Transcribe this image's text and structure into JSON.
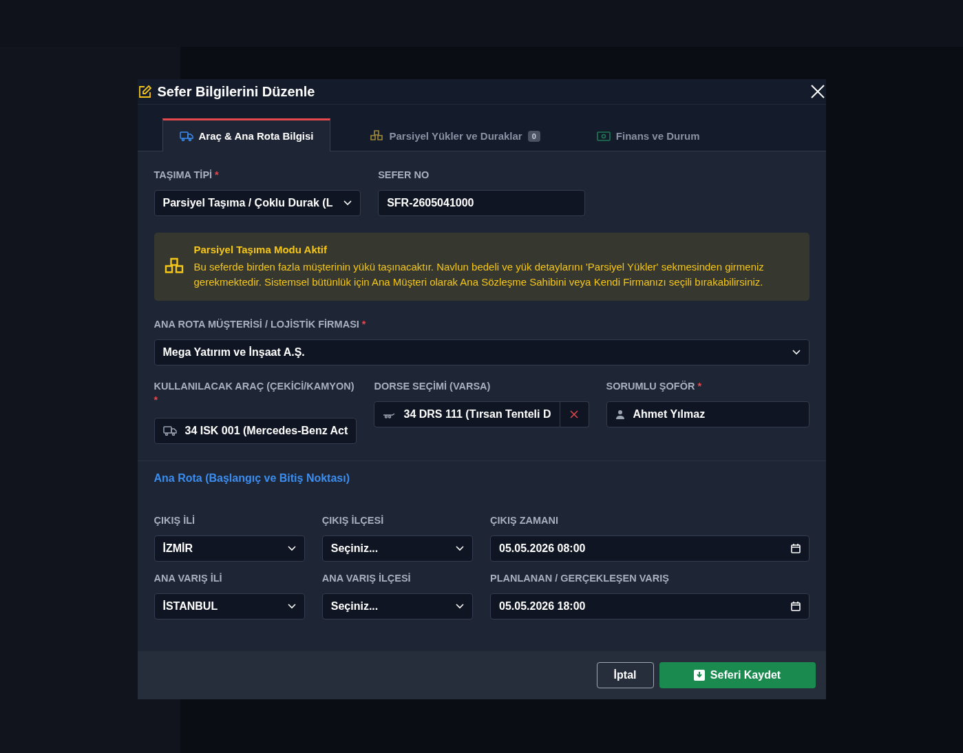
{
  "modal": {
    "title": "Sefer Bilgilerini Düzenle"
  },
  "tabs": [
    {
      "label": "Araç & Ana Rota Bilgisi",
      "selected": true,
      "kind": "truck"
    },
    {
      "label": "Parsiyel Yükler ve Duraklar",
      "selected": false,
      "kind": "boxes",
      "badge": "0"
    },
    {
      "label": "Finans ve Durum",
      "selected": false,
      "kind": "money"
    }
  ],
  "top_fields": [
    {
      "label": "TAŞIMA TİPİ",
      "required_mark": "*",
      "value": "Parsiyel Taşıma / Çoklu Durak (L",
      "kind": "select"
    },
    {
      "label": "SEFER NO",
      "value": "SFR-2605041000",
      "kind": "text"
    }
  ],
  "notice": {
    "title": "Parsiyel Taşıma Modu Aktif",
    "text": "Bu seferde birden fazla müşterinin yükü taşınacaktır. Navlun bedeli ve yük detaylarını 'Parsiyel Yükler' sekmesinden girmeniz gerekmektedir. Sistemsel bütünlük için Ana Müşteri olarak Ana Sözleşme Sahibini veya Kendi Firmanızı seçili bırakabilirsiniz."
  },
  "customer": {
    "label": "ANA ROTA MÜŞTERİSİ / LOJİSTİK FİRMASI",
    "required_mark": "*",
    "value": "Mega Yatırım ve İnşaat A.Ş."
  },
  "assignments": [
    {
      "label": "KULLANILACAK ARAÇ (ÇEKİCİ/KAMYON)",
      "required_mark": "*",
      "value": "34 ISK 001 (Mercedes-Benz Act",
      "kind": "truck"
    },
    {
      "label": "DORSE SEÇİMİ (VARSA)",
      "value": "34 DRS 111 (Tırsan Tenteli D",
      "kind": "trailer"
    },
    {
      "label": "SORUMLU ŞOFÖR",
      "required_mark": "*",
      "value": "Ahmet Yılmaz",
      "kind": "driver"
    }
  ],
  "route": {
    "title": "Ana Rota (Başlangıç ve Bitiş Noktası)",
    "fields": [
      {
        "label": "ÇIKIŞ İLİ",
        "value": "İZMİR",
        "kind": "select"
      },
      {
        "label": "ÇIKIŞ İLÇESİ",
        "value": "Seçiniz...",
        "kind": "select"
      },
      {
        "label": "ÇIKIŞ ZAMANI",
        "value": "05.05.2026 08:00",
        "kind": "datetime"
      },
      {
        "label": "ANA VARIŞ İLİ",
        "value": "İSTANBUL",
        "kind": "select"
      },
      {
        "label": "ANA VARIŞ İLÇESİ",
        "value": "Seçiniz...",
        "kind": "select"
      },
      {
        "label": "PLANLANAN / GERÇEKLEŞEN VARIŞ",
        "value": "05.05.2026 18:00",
        "kind": "datetime"
      }
    ]
  },
  "footer": {
    "cancel": "İptal",
    "save": "Seferi Kaydet"
  }
}
